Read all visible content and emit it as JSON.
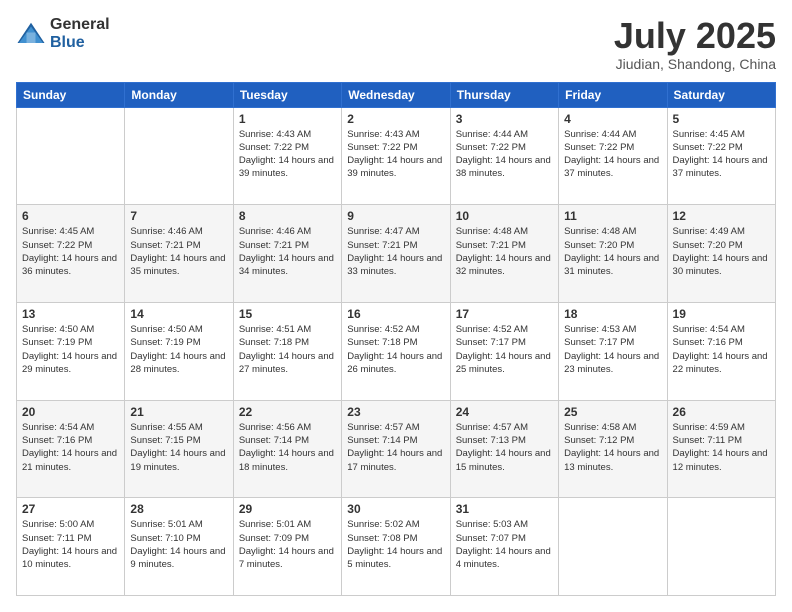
{
  "header": {
    "logo_general": "General",
    "logo_blue": "Blue",
    "month_title": "July 2025",
    "location": "Jiudian, Shandong, China"
  },
  "calendar": {
    "days_of_week": [
      "Sunday",
      "Monday",
      "Tuesday",
      "Wednesday",
      "Thursday",
      "Friday",
      "Saturday"
    ],
    "weeks": [
      [
        {
          "day": "",
          "info": ""
        },
        {
          "day": "",
          "info": ""
        },
        {
          "day": "1",
          "info": "Sunrise: 4:43 AM\nSunset: 7:22 PM\nDaylight: 14 hours\nand 39 minutes."
        },
        {
          "day": "2",
          "info": "Sunrise: 4:43 AM\nSunset: 7:22 PM\nDaylight: 14 hours\nand 39 minutes."
        },
        {
          "day": "3",
          "info": "Sunrise: 4:44 AM\nSunset: 7:22 PM\nDaylight: 14 hours\nand 38 minutes."
        },
        {
          "day": "4",
          "info": "Sunrise: 4:44 AM\nSunset: 7:22 PM\nDaylight: 14 hours\nand 37 minutes."
        },
        {
          "day": "5",
          "info": "Sunrise: 4:45 AM\nSunset: 7:22 PM\nDaylight: 14 hours\nand 37 minutes."
        }
      ],
      [
        {
          "day": "6",
          "info": "Sunrise: 4:45 AM\nSunset: 7:22 PM\nDaylight: 14 hours\nand 36 minutes."
        },
        {
          "day": "7",
          "info": "Sunrise: 4:46 AM\nSunset: 7:21 PM\nDaylight: 14 hours\nand 35 minutes."
        },
        {
          "day": "8",
          "info": "Sunrise: 4:46 AM\nSunset: 7:21 PM\nDaylight: 14 hours\nand 34 minutes."
        },
        {
          "day": "9",
          "info": "Sunrise: 4:47 AM\nSunset: 7:21 PM\nDaylight: 14 hours\nand 33 minutes."
        },
        {
          "day": "10",
          "info": "Sunrise: 4:48 AM\nSunset: 7:21 PM\nDaylight: 14 hours\nand 32 minutes."
        },
        {
          "day": "11",
          "info": "Sunrise: 4:48 AM\nSunset: 7:20 PM\nDaylight: 14 hours\nand 31 minutes."
        },
        {
          "day": "12",
          "info": "Sunrise: 4:49 AM\nSunset: 7:20 PM\nDaylight: 14 hours\nand 30 minutes."
        }
      ],
      [
        {
          "day": "13",
          "info": "Sunrise: 4:50 AM\nSunset: 7:19 PM\nDaylight: 14 hours\nand 29 minutes."
        },
        {
          "day": "14",
          "info": "Sunrise: 4:50 AM\nSunset: 7:19 PM\nDaylight: 14 hours\nand 28 minutes."
        },
        {
          "day": "15",
          "info": "Sunrise: 4:51 AM\nSunset: 7:18 PM\nDaylight: 14 hours\nand 27 minutes."
        },
        {
          "day": "16",
          "info": "Sunrise: 4:52 AM\nSunset: 7:18 PM\nDaylight: 14 hours\nand 26 minutes."
        },
        {
          "day": "17",
          "info": "Sunrise: 4:52 AM\nSunset: 7:17 PM\nDaylight: 14 hours\nand 25 minutes."
        },
        {
          "day": "18",
          "info": "Sunrise: 4:53 AM\nSunset: 7:17 PM\nDaylight: 14 hours\nand 23 minutes."
        },
        {
          "day": "19",
          "info": "Sunrise: 4:54 AM\nSunset: 7:16 PM\nDaylight: 14 hours\nand 22 minutes."
        }
      ],
      [
        {
          "day": "20",
          "info": "Sunrise: 4:54 AM\nSunset: 7:16 PM\nDaylight: 14 hours\nand 21 minutes."
        },
        {
          "day": "21",
          "info": "Sunrise: 4:55 AM\nSunset: 7:15 PM\nDaylight: 14 hours\nand 19 minutes."
        },
        {
          "day": "22",
          "info": "Sunrise: 4:56 AM\nSunset: 7:14 PM\nDaylight: 14 hours\nand 18 minutes."
        },
        {
          "day": "23",
          "info": "Sunrise: 4:57 AM\nSunset: 7:14 PM\nDaylight: 14 hours\nand 17 minutes."
        },
        {
          "day": "24",
          "info": "Sunrise: 4:57 AM\nSunset: 7:13 PM\nDaylight: 14 hours\nand 15 minutes."
        },
        {
          "day": "25",
          "info": "Sunrise: 4:58 AM\nSunset: 7:12 PM\nDaylight: 14 hours\nand 13 minutes."
        },
        {
          "day": "26",
          "info": "Sunrise: 4:59 AM\nSunset: 7:11 PM\nDaylight: 14 hours\nand 12 minutes."
        }
      ],
      [
        {
          "day": "27",
          "info": "Sunrise: 5:00 AM\nSunset: 7:11 PM\nDaylight: 14 hours\nand 10 minutes."
        },
        {
          "day": "28",
          "info": "Sunrise: 5:01 AM\nSunset: 7:10 PM\nDaylight: 14 hours\nand 9 minutes."
        },
        {
          "day": "29",
          "info": "Sunrise: 5:01 AM\nSunset: 7:09 PM\nDaylight: 14 hours\nand 7 minutes."
        },
        {
          "day": "30",
          "info": "Sunrise: 5:02 AM\nSunset: 7:08 PM\nDaylight: 14 hours\nand 5 minutes."
        },
        {
          "day": "31",
          "info": "Sunrise: 5:03 AM\nSunset: 7:07 PM\nDaylight: 14 hours\nand 4 minutes."
        },
        {
          "day": "",
          "info": ""
        },
        {
          "day": "",
          "info": ""
        }
      ]
    ]
  }
}
